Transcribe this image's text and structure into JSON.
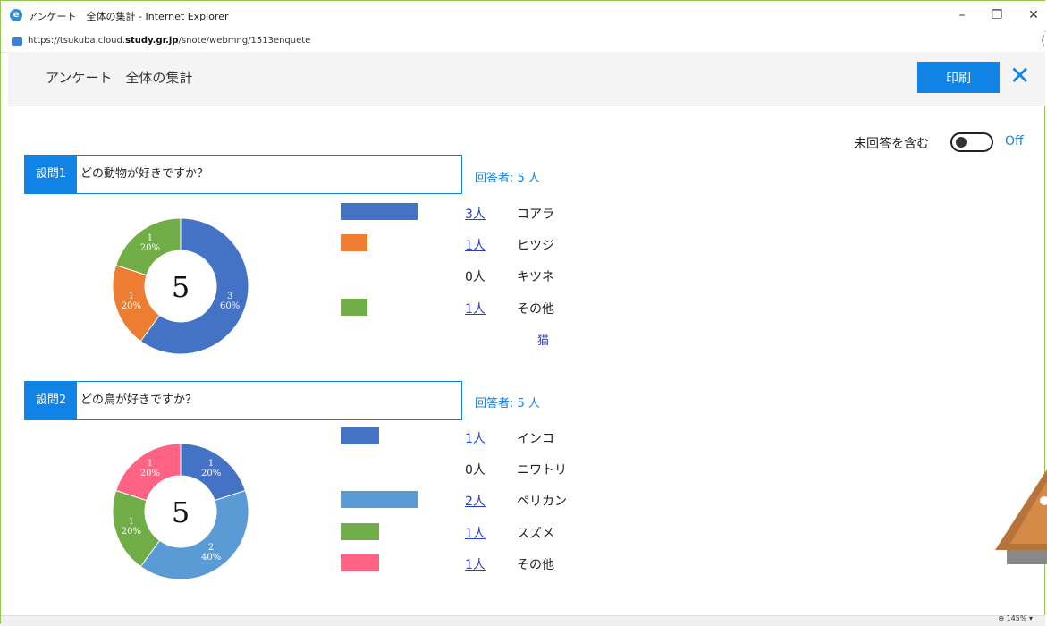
{
  "window": {
    "title": "アンケート　全体の集計 - Internet Explorer",
    "minimize": "–",
    "restore": "❐",
    "close": "✕",
    "url_prefix": "https://tsukuba.cloud.",
    "url_host": "study.gr.jp",
    "url_path": "/snote/webmng/1513enquete",
    "addr_edge": "("
  },
  "header": {
    "title": "アンケート　全体の集計",
    "print_label": "印刷",
    "close_glyph": "✕"
  },
  "toggle": {
    "label": "未回答を含む",
    "state": "Off"
  },
  "questions": [
    {
      "number": "設問1",
      "text": "どの動物が好きですか？",
      "respondents": "回答者:  5  人",
      "total": "5",
      "options": [
        {
          "count": "3人",
          "label": "コアラ",
          "value": 3,
          "color": "#4472c4",
          "percent": "60%"
        },
        {
          "count": "1人",
          "label": "ヒツジ",
          "value": 1,
          "color": "#ed7d31",
          "percent": "20%"
        },
        {
          "count": "0人",
          "label": "キツネ",
          "value": 0,
          "color": "#a5a5a5",
          "percent": "0%"
        },
        {
          "count": "1人",
          "label": "その他",
          "value": 1,
          "color": "#70ad47",
          "percent": "20%"
        }
      ],
      "other_answers": [
        "猫"
      ]
    },
    {
      "number": "設問2",
      "text": "どの鳥が好きですか？",
      "respondents": "回答者:  5  人",
      "total": "5",
      "options": [
        {
          "count": "1人",
          "label": "インコ",
          "value": 1,
          "color": "#4472c4",
          "percent": "20%"
        },
        {
          "count": "0人",
          "label": "ニワトリ",
          "value": 0,
          "color": "#ed7d31",
          "percent": "0%"
        },
        {
          "count": "2人",
          "label": "ペリカン",
          "value": 2,
          "color": "#5b9bd5",
          "percent": "40%"
        },
        {
          "count": "1人",
          "label": "スズメ",
          "value": 1,
          "color": "#70ad47",
          "percent": "20%"
        },
        {
          "count": "1人",
          "label": "その他",
          "value": 1,
          "color": "#ff6384",
          "percent": "20%"
        }
      ]
    }
  ],
  "statusbar": {
    "zoom": "145%"
  }
}
